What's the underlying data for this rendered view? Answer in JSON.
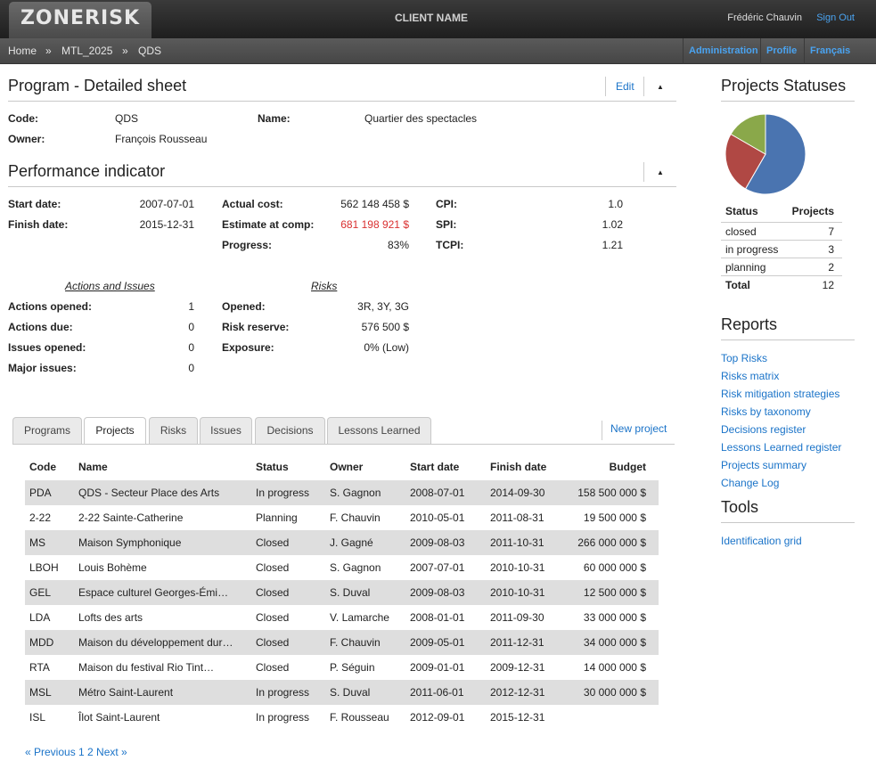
{
  "app": {
    "logo": "ZONERISK",
    "client": "CLIENT NAME",
    "user": "Frédéric Chauvin",
    "sign_out": "Sign Out"
  },
  "breadcrumb": [
    "Home",
    "»",
    "MTL_2025",
    "»",
    "QDS"
  ],
  "subnav": [
    "Administration",
    "Profile",
    "Français"
  ],
  "program": {
    "title": "Program - Detailed sheet",
    "edit": "Edit",
    "code_label": "Code:",
    "code": "QDS",
    "name_label": "Name:",
    "name": "Quartier des spectacles",
    "owner_label": "Owner:",
    "owner": "François Rousseau"
  },
  "performance": {
    "title": "Performance indicator",
    "start_label": "Start date:",
    "start": "2007-07-01",
    "finish_label": "Finish date:",
    "finish": "2015-12-31",
    "actual_label": "Actual cost:",
    "actual": "562 148 458 $",
    "estimate_label": "Estimate at comp:",
    "estimate": "681 198 921 $",
    "progress_label": "Progress:",
    "progress": "83%",
    "cpi_label": "CPI:",
    "cpi": "1.0",
    "spi_label": "SPI:",
    "spi": "1.02",
    "tcpi_label": "TCPI:",
    "tcpi": "1.21",
    "actions_title": "Actions and Issues",
    "risks_title": "Risks",
    "actions_opened_label": "Actions opened:",
    "actions_opened": "1",
    "actions_due_label": "Actions due:",
    "actions_due": "0",
    "issues_opened_label": "Issues opened:",
    "issues_opened": "0",
    "major_issues_label": "Major issues:",
    "major_issues": "0",
    "opened_label": "Opened:",
    "opened": "3R, 3Y, 3G",
    "reserve_label": "Risk reserve:",
    "reserve": "576 500 $",
    "exposure_label": "Exposure:",
    "exposure": "0% (Low)"
  },
  "tabs": [
    "Programs",
    "Projects",
    "Risks",
    "Issues",
    "Decisions",
    "Lessons Learned"
  ],
  "new_project": "New project",
  "table": {
    "headers": [
      "Code",
      "Name",
      "Status",
      "Owner",
      "Start date",
      "Finish date",
      "Budget"
    ],
    "rows": [
      [
        "PDA",
        "QDS - Secteur Place des Arts",
        "In progress",
        "S. Gagnon",
        "2008-07-01",
        "2014-09-30",
        "158 500 000 $"
      ],
      [
        "2-22",
        "2-22 Sainte-Catherine",
        "Planning",
        "F. Chauvin",
        "2010-05-01",
        "2011-08-31",
        "19 500 000 $"
      ],
      [
        "MS",
        "Maison Symphonique",
        "Closed",
        "J. Gagné",
        "2009-08-03",
        "2011-10-31",
        "266 000 000 $"
      ],
      [
        "LBOH",
        "Louis Bohème",
        "Closed",
        "S. Gagnon",
        "2007-07-01",
        "2010-10-31",
        "60 000 000 $"
      ],
      [
        "GEL",
        "Espace culturel Georges-Émi…",
        "Closed",
        "S. Duval",
        "2009-08-03",
        "2010-10-31",
        "12 500 000 $"
      ],
      [
        "LDA",
        "Lofts des arts",
        "Closed",
        "V. Lamarche",
        "2008-01-01",
        "2011-09-30",
        "33 000 000 $"
      ],
      [
        "MDD",
        "Maison du développement dur…",
        "Closed",
        "F. Chauvin",
        "2009-05-01",
        "2011-12-31",
        "34 000 000 $"
      ],
      [
        "RTA",
        "Maison du festival Rio Tint…",
        "Closed",
        "P. Séguin",
        "2009-01-01",
        "2009-12-31",
        "14 000 000 $"
      ],
      [
        "MSL",
        "Métro Saint-Laurent",
        "In progress",
        "S. Duval",
        "2011-06-01",
        "2012-12-31",
        "30 000 000 $"
      ],
      [
        "ISL",
        "Îlot Saint-Laurent",
        "In progress",
        "F. Rousseau",
        "2012-09-01",
        "2015-12-31",
        ""
      ]
    ]
  },
  "pagination": "« Previous 1 2 Next »",
  "statuses": {
    "title": "Projects Statuses",
    "col_status": "Status",
    "col_projects": "Projects",
    "rows": [
      [
        "closed",
        "7"
      ],
      [
        "in progress",
        "3"
      ],
      [
        "planning",
        "2"
      ]
    ],
    "total_label": "Total",
    "total": "12",
    "colors": [
      "#4a74b0",
      "#b04844",
      "#8aa84a"
    ]
  },
  "reports": {
    "title": "Reports",
    "links": [
      "Top Risks",
      "Risks matrix",
      "Risk mitigation strategies",
      "Risks by taxonomy",
      "Decisions register",
      "Lessons Learned register",
      "Projects summary",
      "Change Log"
    ]
  },
  "tools": {
    "title": "Tools",
    "links": [
      "Identification grid"
    ]
  }
}
